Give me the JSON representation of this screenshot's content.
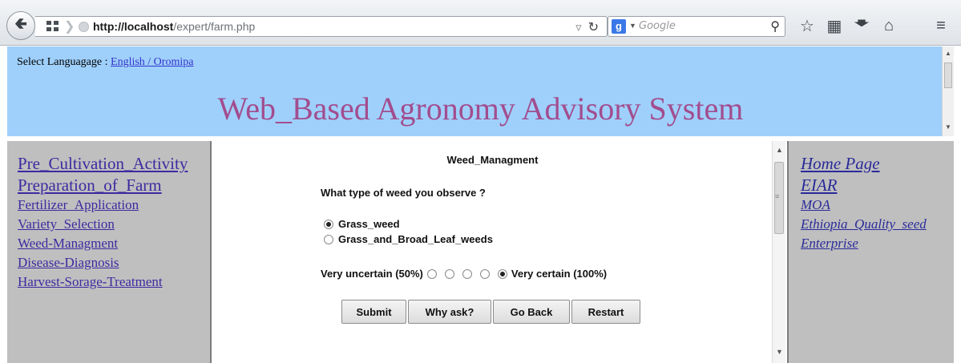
{
  "browser": {
    "url_host": "http://localhost",
    "url_path": "/expert/farm.php",
    "search_placeholder": "Google",
    "search_engine_letter": "g"
  },
  "banner": {
    "language_prefix": "Select Languagage : ",
    "language_options": "English / Oromipa",
    "site_title": "Web_Based Agronomy Advisory System",
    "background_color": "#9fd0fb",
    "title_color": "#a24d8e"
  },
  "left_menu": {
    "items": [
      "Pre_Cultivation_Activity",
      "Preparation_of_Farm",
      "Fertilizer_Application",
      "Variety_Selection",
      "Weed-Managment",
      "Disease-Diagnosis",
      "Harvest-Sorage-Treatment"
    ]
  },
  "main": {
    "section_title": "Weed_Managment",
    "question": "What type of weed you observe ?",
    "options": [
      {
        "label": "Grass_weed",
        "selected": true
      },
      {
        "label": "Grass_and_Broad_Leaf_weeds",
        "selected": false
      }
    ],
    "certainty": {
      "low_label": "Very uncertain (50%)",
      "high_label": "Very certain (100%)",
      "selected_index": 5
    },
    "buttons": {
      "submit": "Submit",
      "why_ask": "Why ask?",
      "go_back": "Go Back",
      "restart": "Restart"
    }
  },
  "right_menu": {
    "items": [
      "Home Page",
      "EIAR",
      "MOA",
      "Ethiopia_Quality_seed",
      "Enterprise"
    ]
  },
  "icons": {
    "back": "back-arrow-icon",
    "reload": "reload-icon",
    "bookmark": "star-icon",
    "reading_list": "bookmarks-list-icon",
    "downloads": "download-icon",
    "home": "home-icon",
    "menu": "hamburger-menu-icon"
  }
}
